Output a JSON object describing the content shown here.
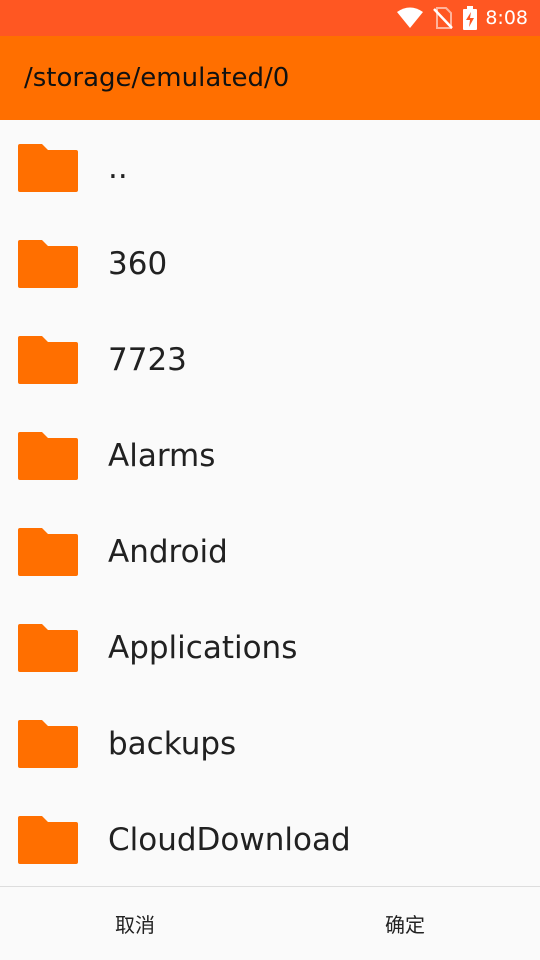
{
  "status_bar": {
    "time": "8:08",
    "background": "#ff5722",
    "icons": [
      "wifi-icon",
      "no-sim-icon",
      "battery-charging-icon"
    ]
  },
  "app_bar": {
    "title": "/storage/emulated/0",
    "background": "#ff6f00"
  },
  "folders": [
    {
      "name": ".."
    },
    {
      "name": "360"
    },
    {
      "name": "7723"
    },
    {
      "name": "Alarms"
    },
    {
      "name": "Android"
    },
    {
      "name": "Applications"
    },
    {
      "name": "backups"
    },
    {
      "name": "CloudDownload"
    }
  ],
  "folder_icon": {
    "name": "folder-icon",
    "color": "#ff6f00"
  },
  "footer": {
    "cancel_label": "取消",
    "confirm_label": "确定"
  }
}
